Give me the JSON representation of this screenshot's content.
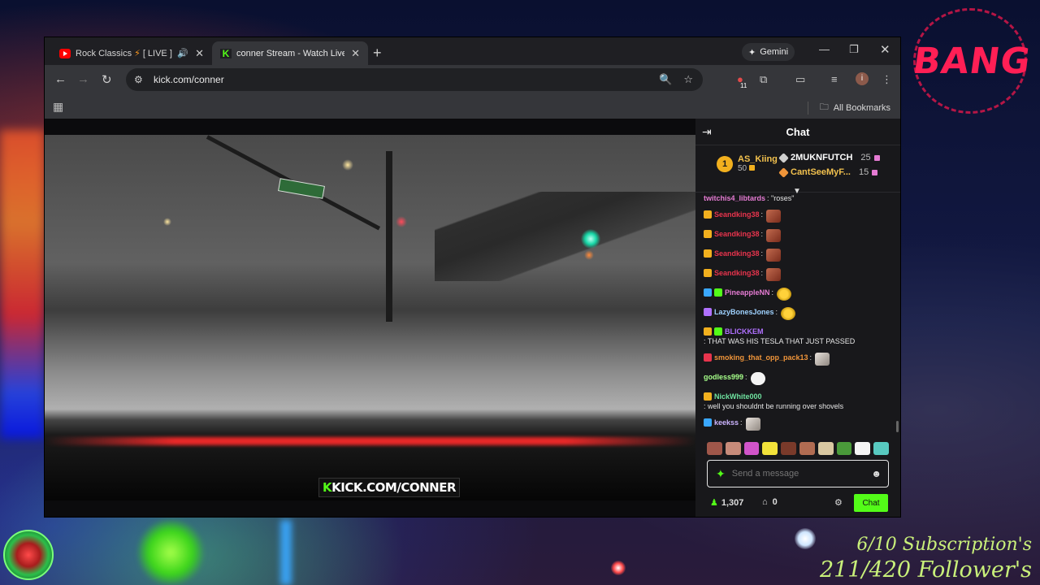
{
  "browser": {
    "tabs": [
      {
        "title": "Rock Classics",
        "title2": "[ LIVE ] Ti",
        "audio": true
      },
      {
        "title": "conner Stream - Watch Live on"
      }
    ],
    "gemini_label": "Gemini",
    "url": "kick.com/conner",
    "bookmarks_label": "All Bookmarks",
    "extension_badge": "11",
    "profile_initial": "i"
  },
  "stream": {
    "watermark_k": "K",
    "watermark_text": "KICK.COM/CONNER"
  },
  "chat": {
    "title": "Chat",
    "leaderboard": {
      "first": {
        "rank": "1",
        "name": "AS_Kiing",
        "count": "50"
      },
      "second": {
        "name": "2MUKNFUTCH",
        "count": "25"
      },
      "third": {
        "name": "CantSeeMyF...",
        "count": "15"
      }
    },
    "messages": [
      {
        "user": "twitchis4_libtards",
        "color": "#e57bd3",
        "text": ": \"roses\"",
        "badges": [],
        "emote": ""
      },
      {
        "user": "Seandking38",
        "color": "#e8344d",
        "text": ":",
        "badges": [
          "#f2b01e"
        ],
        "emote": "face"
      },
      {
        "user": "Seandking38",
        "color": "#e8344d",
        "text": ":",
        "badges": [
          "#f2b01e"
        ],
        "emote": "face"
      },
      {
        "user": "Seandking38",
        "color": "#e8344d",
        "text": ":",
        "badges": [
          "#f2b01e"
        ],
        "emote": "face"
      },
      {
        "user": "Seandking38",
        "color": "#e8344d",
        "text": ":",
        "badges": [
          "#f2b01e"
        ],
        "emote": "face"
      },
      {
        "user": "PineappleNN",
        "color": "#e57bd3",
        "text": ":",
        "badges": [
          "#3aa8ff",
          "#53fc18"
        ],
        "emote": "laugh"
      },
      {
        "user": "LazyBonesJones",
        "color": "#9fd2ff",
        "text": ":",
        "badges": [
          "#b071ff"
        ],
        "emote": "laugh"
      },
      {
        "user": "BLICKKEM",
        "color": "#b071ff",
        "text": ": THAT WAS HIS TESLA THAT JUST PASSED",
        "badges": [
          "#f2b01e",
          "#53fc18"
        ],
        "emote": ""
      },
      {
        "user": "smoking_that_opp_pack13",
        "color": "#f0953a",
        "text": ":",
        "badges": [
          "#e8344d"
        ],
        "emote": "cat"
      },
      {
        "user": "godless999",
        "color": "#a6ff8a",
        "text": ":",
        "badges": [],
        "emote": "cloud"
      },
      {
        "user": "NickWhite000",
        "color": "#6fe3a0",
        "text": ": well you shouldnt be running over shovels",
        "badges": [
          "#f2b01e"
        ],
        "emote": ""
      },
      {
        "user": "keekss",
        "color": "#ccb4ff",
        "text": ":",
        "badges": [
          "#3aa8ff"
        ],
        "emote": "cat"
      }
    ],
    "input_placeholder": "Send a message",
    "viewers": "1,307",
    "shop_count": "0",
    "send_label": "Chat"
  },
  "overlay": {
    "brand": "BANG",
    "subscriptions": "6/10 Subscription's",
    "followers": "211/420 Follower's"
  }
}
